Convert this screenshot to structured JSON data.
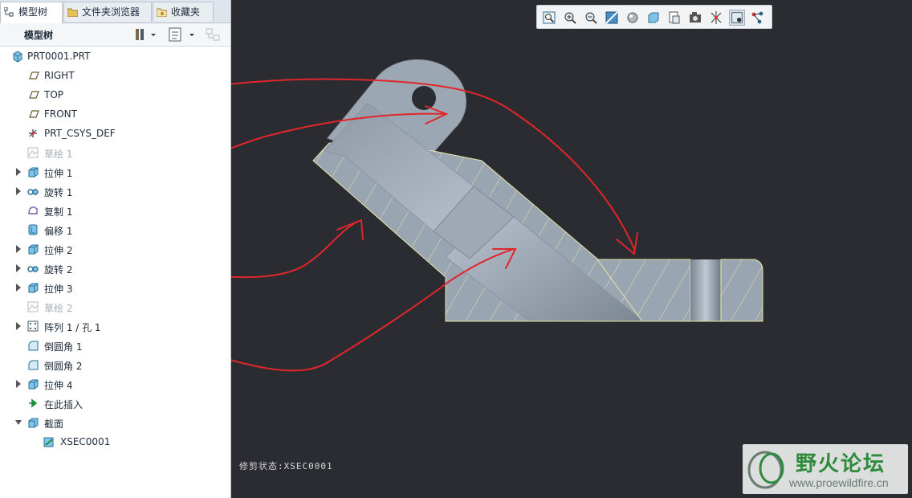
{
  "tabs": [
    {
      "label": "模型树",
      "icon": "model-tree-icon"
    },
    {
      "label": "文件夹浏览器",
      "icon": "folder-icon"
    },
    {
      "label": "收藏夹",
      "icon": "favorites-icon"
    }
  ],
  "tree_panel": {
    "title": "模型树",
    "toolbar_icons": [
      "settings-icon",
      "tree-filter-icon",
      "show-columns-icon"
    ]
  },
  "tree": [
    {
      "label": "PRT0001.PRT",
      "icon": "part-icon",
      "expander": false,
      "dim": false
    },
    {
      "label": "RIGHT",
      "icon": "datum-plane-icon",
      "expander": false,
      "dim": false
    },
    {
      "label": "TOP",
      "icon": "datum-plane-icon",
      "expander": false,
      "dim": false
    },
    {
      "label": "FRONT",
      "icon": "datum-plane-icon",
      "expander": false,
      "dim": false
    },
    {
      "label": "PRT_CSYS_DEF",
      "icon": "csys-icon",
      "expander": false,
      "dim": false
    },
    {
      "label": "草绘 1",
      "icon": "sketch-icon",
      "expander": false,
      "dim": true
    },
    {
      "label": "拉伸 1",
      "icon": "extrude-icon",
      "expander": true,
      "dim": false
    },
    {
      "label": "旋转 1",
      "icon": "revolve-icon",
      "expander": true,
      "dim": false
    },
    {
      "label": "复制 1",
      "icon": "copy-icon",
      "expander": false,
      "dim": false
    },
    {
      "label": "偏移 1",
      "icon": "offset-icon",
      "expander": false,
      "dim": false
    },
    {
      "label": "拉伸 2",
      "icon": "extrude-icon",
      "expander": true,
      "dim": false
    },
    {
      "label": "旋转 2",
      "icon": "revolve-icon",
      "expander": true,
      "dim": false
    },
    {
      "label": "拉伸 3",
      "icon": "extrude-icon",
      "expander": true,
      "dim": false
    },
    {
      "label": "草绘 2",
      "icon": "sketch-icon",
      "expander": false,
      "dim": true
    },
    {
      "label": "阵列 1 / 孔 1",
      "icon": "pattern-icon",
      "expander": true,
      "dim": false
    },
    {
      "label": "倒圆角 1",
      "icon": "round-icon",
      "expander": false,
      "dim": false
    },
    {
      "label": "倒圆角 2",
      "icon": "round-icon",
      "expander": false,
      "dim": false
    },
    {
      "label": "拉伸 4",
      "icon": "extrude-icon",
      "expander": true,
      "dim": false
    },
    {
      "label": "在此插入",
      "icon": "insert-here-icon",
      "expander": false,
      "dim": false
    },
    {
      "label": "截面",
      "icon": "section-icon",
      "expander": "open",
      "dim": false
    },
    {
      "label": "XSEC0001",
      "icon": "xsection-icon",
      "expander": false,
      "dim": false,
      "indent": 1
    }
  ],
  "view_toolbar": [
    "refit-icon",
    "zoom-in-icon",
    "zoom-out-icon",
    "repaint-icon",
    "display-style-icon",
    "saved-orientations-icon",
    "view-manager-icon",
    "perspective-icon",
    "datum-display-icon",
    "spin-center-icon",
    "annotation-display-icon"
  ],
  "status_text": "修剪状态:XSEC0001",
  "watermark": {
    "title": "野火论坛",
    "url": "www.proewildfire.cn"
  },
  "colors": {
    "background": "#2b2b32",
    "part": "#9ba6b3",
    "section_hatch": "#e6e6a8",
    "annotation": "#e0262a"
  }
}
